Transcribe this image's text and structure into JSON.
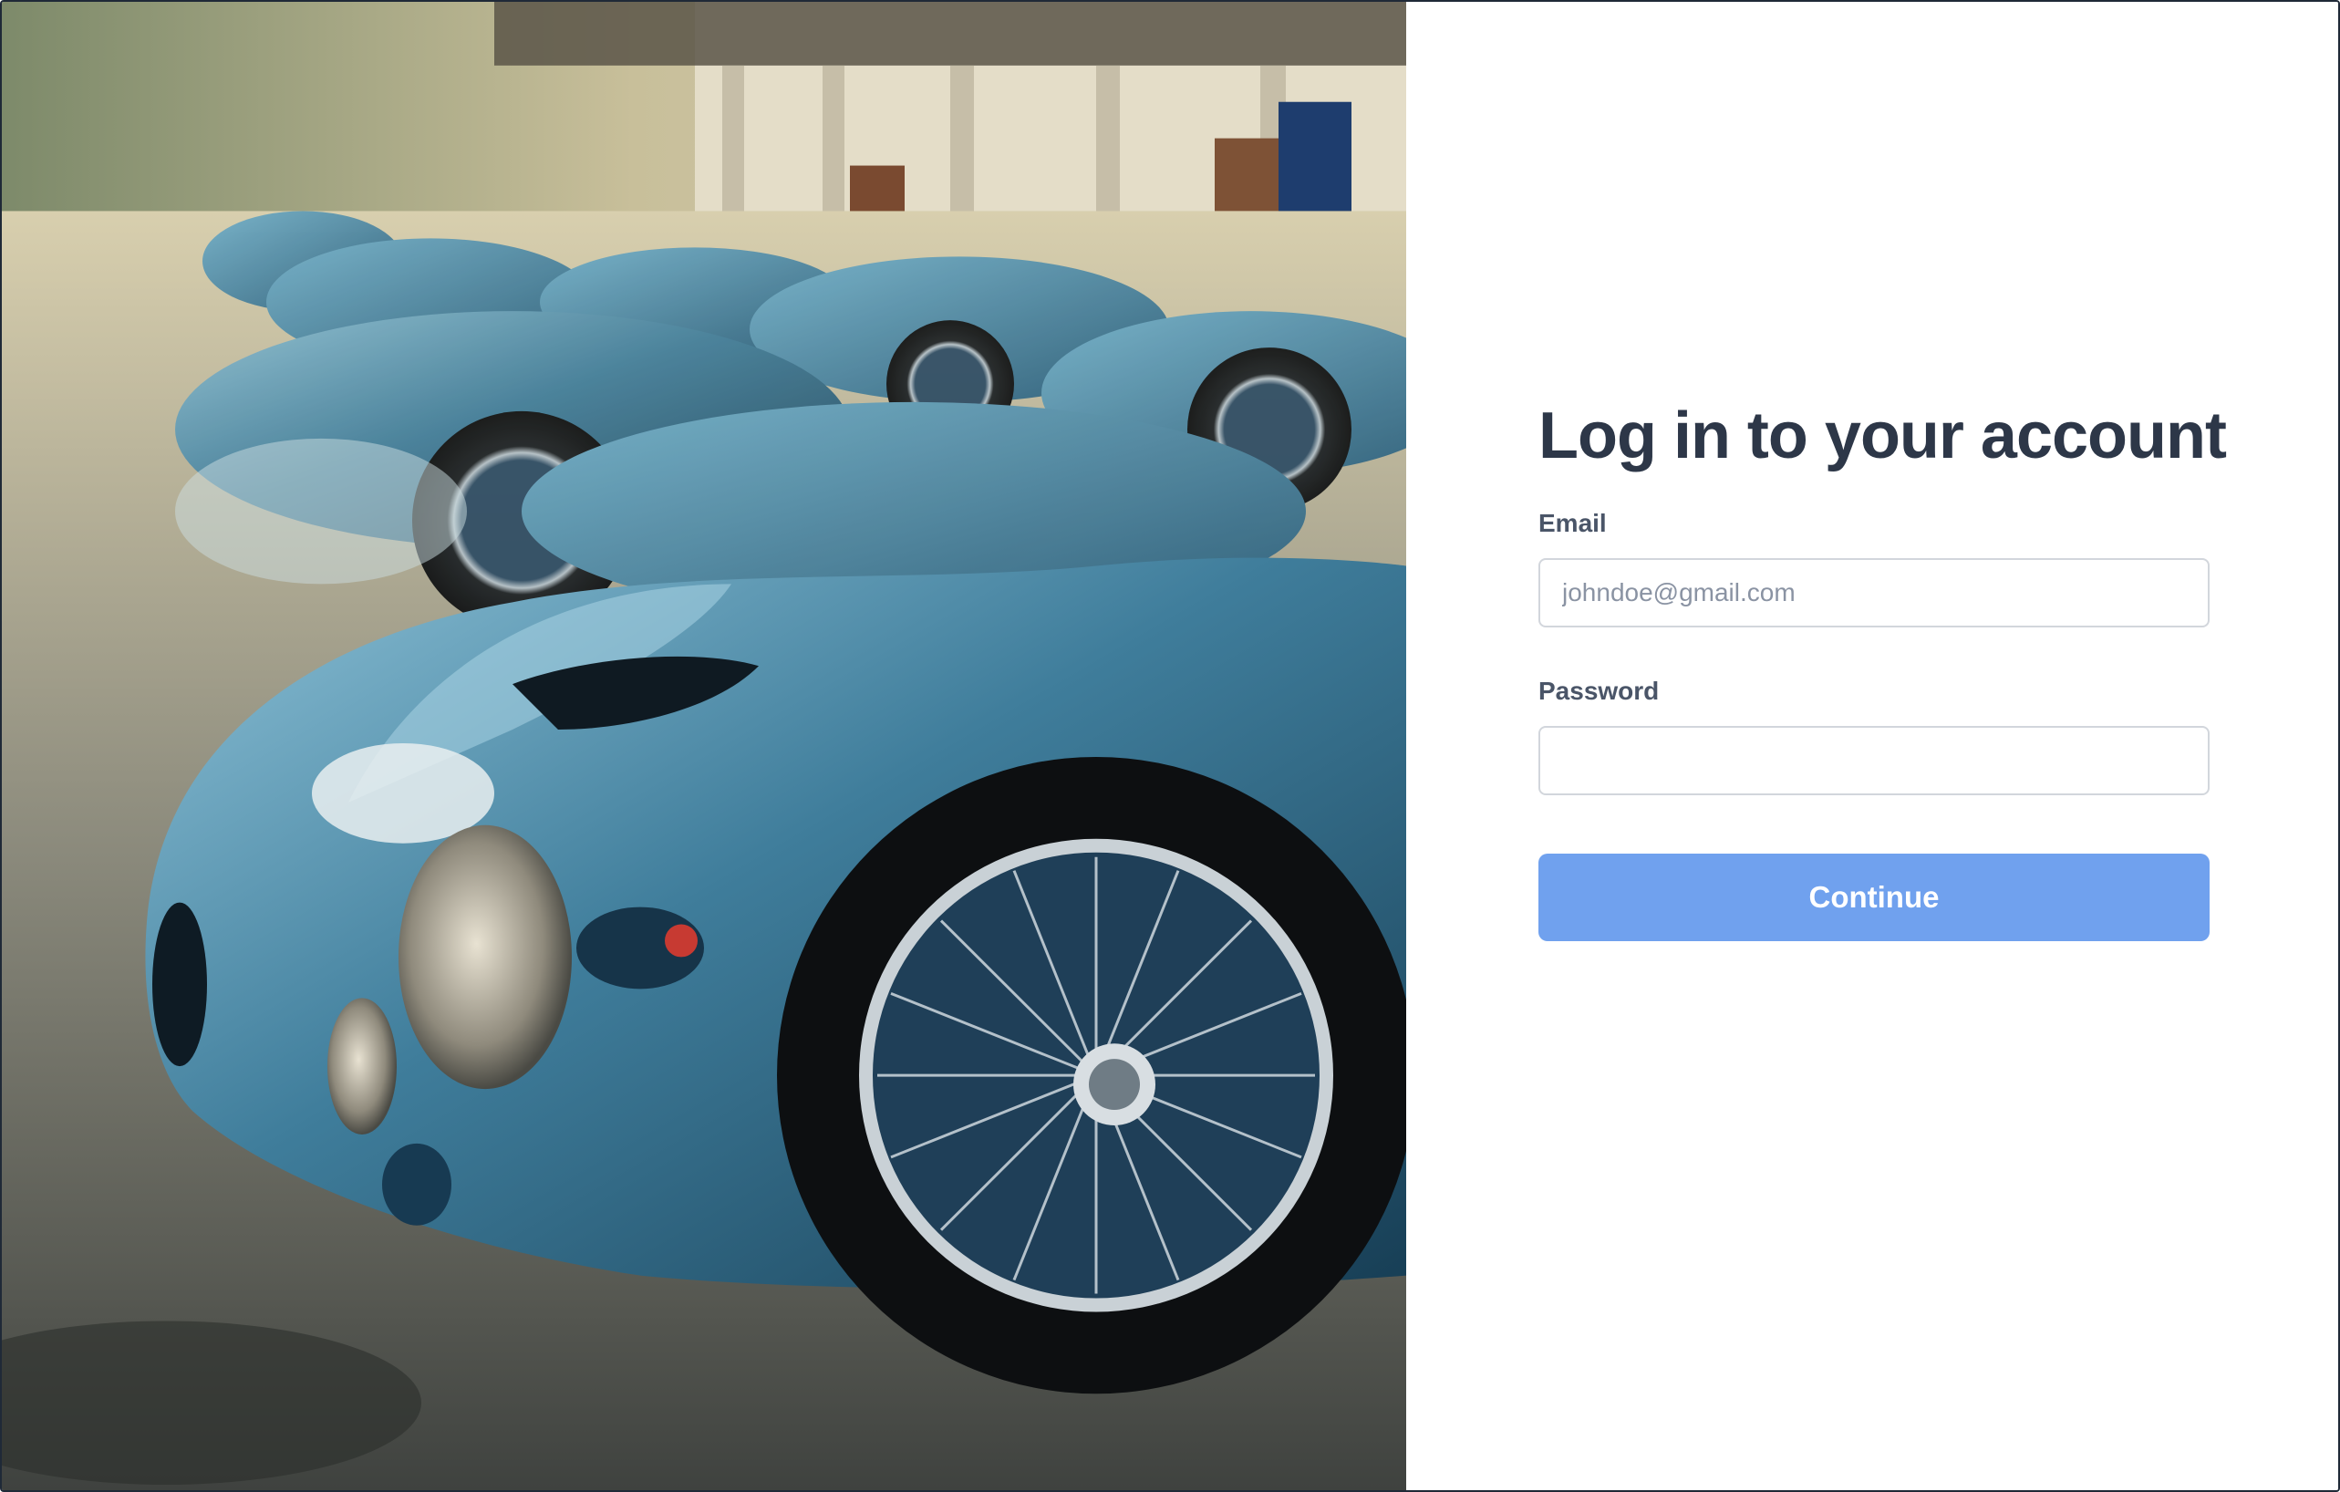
{
  "hero": {
    "image": "vintage-blue-race-cars-photo"
  },
  "login": {
    "title": "Log in to your account",
    "email_label": "Email",
    "email_placeholder": "johndoe@gmail.com",
    "email_value": "",
    "password_label": "Password",
    "password_value": "",
    "continue_label": "Continue"
  },
  "colors": {
    "title": "#2d3748",
    "label": "#4a5568",
    "button": "#70a1ee",
    "border": "#d2d6dc"
  }
}
